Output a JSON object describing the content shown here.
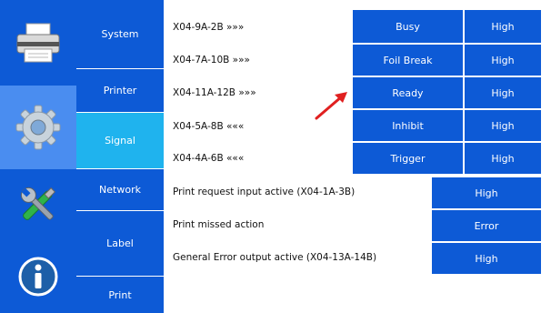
{
  "rail": {
    "items": [
      {
        "name": "printer-icon"
      },
      {
        "name": "gear-icon"
      },
      {
        "name": "tools-icon"
      },
      {
        "name": "info-icon"
      }
    ],
    "colors": {
      "background": "#0d5ad6",
      "active": "#4a8df0"
    }
  },
  "menu": {
    "items": [
      {
        "label": "System"
      },
      {
        "label": "Printer"
      },
      {
        "label": "Signal"
      },
      {
        "label": "Network"
      },
      {
        "label": "Label"
      },
      {
        "label": "Print"
      }
    ],
    "active": "Signal",
    "colors": {
      "background": "#0d5ad6",
      "active": "#1fb3ee"
    }
  },
  "signals": {
    "connectors": [
      "X04-9A-2B »»»",
      "X04-7A-10B »»»",
      "X04-11A-12B »»»",
      "X04-5A-8B «««",
      "X04-4A-6B «««"
    ],
    "grid": [
      {
        "name": "Busy",
        "value": "High"
      },
      {
        "name": "Foil Break",
        "value": "High"
      },
      {
        "name": "Ready",
        "value": "High"
      },
      {
        "name": "Inhibit",
        "value": "High"
      },
      {
        "name": "Trigger",
        "value": "High"
      }
    ],
    "settings": [
      {
        "label": "Print request input active (X04-1A-3B)",
        "value": "High"
      },
      {
        "label": "Print missed action",
        "value": "Error"
      },
      {
        "label": "General Error output active (X04-13A-14B)",
        "value": "High"
      }
    ],
    "annotation": {
      "arrow_color": "#e02020",
      "points_to": "Ready"
    }
  }
}
